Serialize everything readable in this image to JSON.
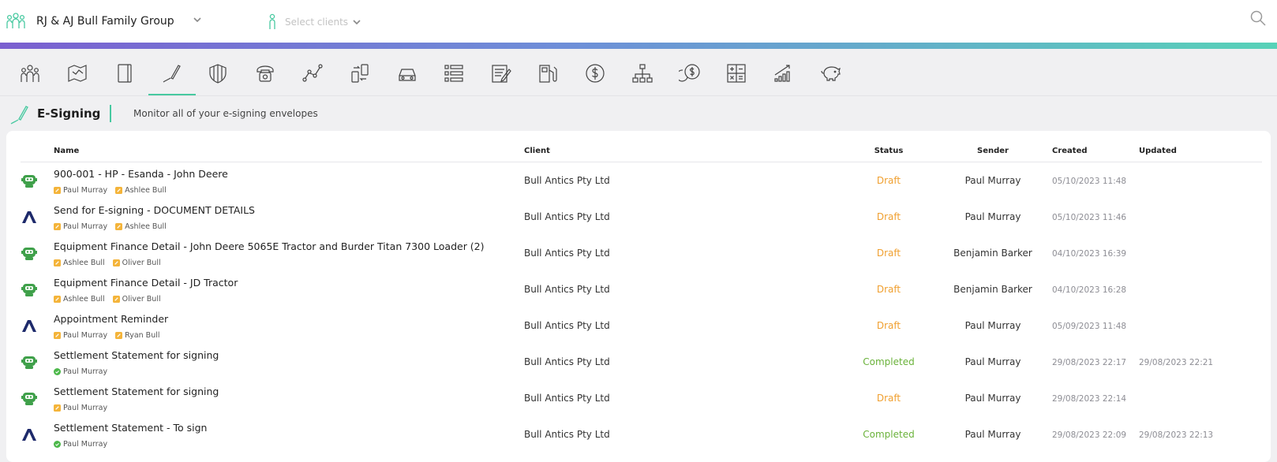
{
  "header": {
    "group_name": "RJ & AJ Bull Family Group",
    "client_placeholder": "Select clients"
  },
  "toolbar": {
    "tools": [
      {
        "name": "family"
      },
      {
        "name": "map"
      },
      {
        "name": "notebook"
      },
      {
        "name": "e-signing"
      },
      {
        "name": "shield"
      },
      {
        "name": "phone"
      },
      {
        "name": "line-chart"
      },
      {
        "name": "transfer"
      },
      {
        "name": "car"
      },
      {
        "name": "list"
      },
      {
        "name": "form"
      },
      {
        "name": "fuel"
      },
      {
        "name": "dollar"
      },
      {
        "name": "hierarchy"
      },
      {
        "name": "coins"
      },
      {
        "name": "calculator"
      },
      {
        "name": "growth"
      },
      {
        "name": "piggy-bank"
      }
    ],
    "active": "e-signing"
  },
  "section": {
    "title": "E-Signing",
    "subtitle": "Monitor all of your e-signing envelopes"
  },
  "table": {
    "headers": {
      "name": "Name",
      "client": "Client",
      "status": "Status",
      "sender": "Sender",
      "created": "Created",
      "updated": "Updated"
    },
    "rows": [
      {
        "provider": "robot",
        "name": "900-001 - HP - Esanda - John Deere",
        "signers": [
          {
            "name": "Paul Murray",
            "state": "pending"
          },
          {
            "name": "Ashlee Bull",
            "state": "pending"
          }
        ],
        "client": "Bull Antics Pty Ltd",
        "status": "Draft",
        "sender": "Paul Murray",
        "created": "05/10/2023 11:48",
        "updated": ""
      },
      {
        "provider": "adobe",
        "name": "Send for E-signing - DOCUMENT DETAILS",
        "signers": [
          {
            "name": "Paul Murray",
            "state": "pending"
          },
          {
            "name": "Ashlee Bull",
            "state": "pending"
          }
        ],
        "client": "Bull Antics Pty Ltd",
        "status": "Draft",
        "sender": "Paul Murray",
        "created": "05/10/2023 11:46",
        "updated": ""
      },
      {
        "provider": "robot",
        "name": "Equipment Finance Detail - John Deere 5065E Tractor and Burder Titan 7300 Loader (2)",
        "signers": [
          {
            "name": "Ashlee Bull",
            "state": "pending"
          },
          {
            "name": "Oliver Bull",
            "state": "pending"
          }
        ],
        "client": "Bull Antics Pty Ltd",
        "status": "Draft",
        "sender": "Benjamin Barker",
        "created": "04/10/2023 16:39",
        "updated": ""
      },
      {
        "provider": "robot",
        "name": "Equipment Finance Detail - JD Tractor",
        "signers": [
          {
            "name": "Ashlee Bull",
            "state": "pending"
          },
          {
            "name": "Oliver Bull",
            "state": "pending"
          }
        ],
        "client": "Bull Antics Pty Ltd",
        "status": "Draft",
        "sender": "Benjamin Barker",
        "created": "04/10/2023 16:28",
        "updated": ""
      },
      {
        "provider": "adobe",
        "name": "Appointment Reminder",
        "signers": [
          {
            "name": "Paul Murray",
            "state": "pending"
          },
          {
            "name": "Ryan Bull",
            "state": "pending"
          }
        ],
        "client": "Bull Antics Pty Ltd",
        "status": "Draft",
        "sender": "Paul Murray",
        "created": "05/09/2023 11:48",
        "updated": ""
      },
      {
        "provider": "robot",
        "name": "Settlement Statement for signing",
        "signers": [
          {
            "name": "Paul Murray",
            "state": "done"
          }
        ],
        "client": "Bull Antics Pty Ltd",
        "status": "Completed",
        "sender": "Paul Murray",
        "created": "29/08/2023 22:17",
        "updated": "29/08/2023 22:21"
      },
      {
        "provider": "robot",
        "name": "Settlement Statement for signing",
        "signers": [
          {
            "name": "Paul Murray",
            "state": "pending"
          }
        ],
        "client": "Bull Antics Pty Ltd",
        "status": "Draft",
        "sender": "Paul Murray",
        "created": "29/08/2023 22:14",
        "updated": ""
      },
      {
        "provider": "adobe",
        "name": "Settlement Statement - To sign",
        "signers": [
          {
            "name": "Paul Murray",
            "state": "done"
          }
        ],
        "client": "Bull Antics Pty Ltd",
        "status": "Completed",
        "sender": "Paul Murray",
        "created": "29/08/2023 22:09",
        "updated": "29/08/2023 22:13"
      }
    ]
  },
  "colors": {
    "accent": "#47c9a0",
    "draft": "#f0a030",
    "completed": "#6ab23a",
    "robot": "#3fa04a",
    "adobe": "#1e2a6b",
    "signer_pending": "#f4b43a",
    "signer_done": "#4cb84a"
  }
}
